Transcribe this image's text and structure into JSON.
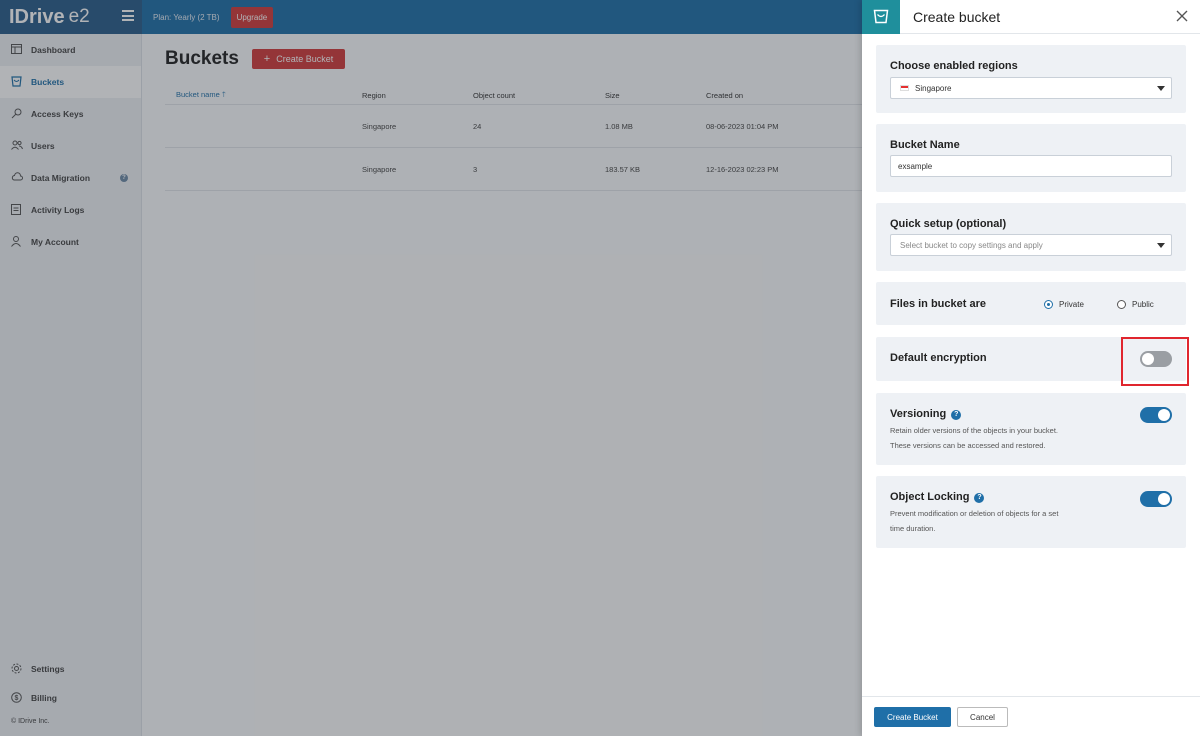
{
  "topbar": {
    "logo": "IDrive",
    "logo_suffix": "e2",
    "plan": "Plan: Yearly (2 TB)",
    "upgrade": "Upgrade"
  },
  "sidebar": {
    "items": [
      {
        "label": "Dashboard",
        "icon": "dashboard-icon"
      },
      {
        "label": "Buckets",
        "icon": "bucket-icon"
      },
      {
        "label": "Access Keys",
        "icon": "key-icon"
      },
      {
        "label": "Users",
        "icon": "users-icon"
      },
      {
        "label": "Data Migration",
        "icon": "cloud-icon"
      },
      {
        "label": "Activity Logs",
        "icon": "document-icon"
      },
      {
        "label": "My Account",
        "icon": "user-icon"
      }
    ],
    "bottom_items": [
      {
        "label": "Settings",
        "icon": "gear-icon"
      },
      {
        "label": "Billing",
        "icon": "dollar-icon"
      }
    ],
    "copyright": "© IDrive Inc."
  },
  "main": {
    "title": "Buckets",
    "create_button": "Create Bucket",
    "columns": [
      "Bucket name",
      "Region",
      "Object count",
      "Size",
      "Created on"
    ],
    "rows": [
      {
        "name": "",
        "region": "Singapore",
        "count": "24",
        "size": "1.08 MB",
        "created": "08-06-2023 01:04 PM"
      },
      {
        "name": "",
        "region": "Singapore",
        "count": "3",
        "size": "183.57 KB",
        "created": "12-16-2023 02:23 PM"
      }
    ]
  },
  "panel": {
    "title": "Create bucket",
    "regions_label": "Choose enabled regions",
    "region_value": "Singapore",
    "bucket_name_label": "Bucket Name",
    "bucket_name_value": "exsample",
    "quick_setup_label": "Quick setup (optional)",
    "quick_setup_placeholder": "Select bucket to copy settings and apply",
    "files_label": "Files in bucket are",
    "radio_private": "Private",
    "radio_public": "Public",
    "selected_access": "Private",
    "encryption_label": "Default encryption",
    "encryption_on": false,
    "versioning_label": "Versioning",
    "versioning_desc_1": "Retain older versions of the objects in your bucket.",
    "versioning_desc_2": "These versions can be accessed and restored.",
    "versioning_on": true,
    "locking_label": "Object Locking",
    "locking_desc_1": "Prevent modification or deletion of objects for a set",
    "locking_desc_2": "time duration.",
    "locking_on": true,
    "create_button": "Create Bucket",
    "cancel_button": "Cancel"
  },
  "colors": {
    "brand_blue": "#1f6fa8",
    "upgrade_red": "#d23b3b",
    "highlight_red": "#e0262e",
    "teal": "#1f8f9c"
  }
}
